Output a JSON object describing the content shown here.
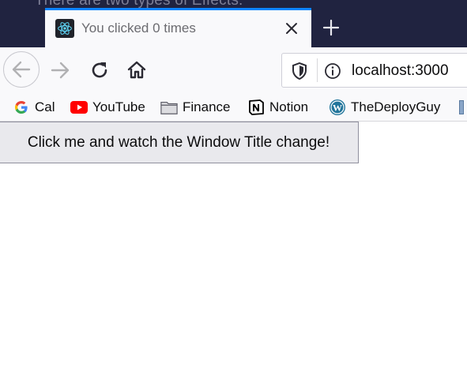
{
  "window": {
    "behind_text": "There are two types of Effects:"
  },
  "tab": {
    "title": "You clicked 0 times",
    "favicon": "react-logo-icon",
    "close_icon": "close-icon"
  },
  "toolbar": {
    "new_tab_icon": "plus-icon",
    "back_icon": "arrow-left-icon",
    "forward_icon": "arrow-right-icon",
    "reload_icon": "reload-icon",
    "home_icon": "home-icon"
  },
  "urlbar": {
    "url": "localhost:3000",
    "shield_icon": "shield-icon",
    "info_icon": "info-icon"
  },
  "bookmarks": [
    {
      "label": "Cal",
      "icon": "google-icon"
    },
    {
      "label": "YouTube",
      "icon": "youtube-icon"
    },
    {
      "label": "Finance",
      "icon": "folder-icon"
    },
    {
      "label": "Notion",
      "icon": "notion-icon"
    },
    {
      "label": "TheDeployGuy",
      "icon": "wordpress-icon"
    }
  ],
  "content": {
    "button_label": "Click me and watch the Window Title change!"
  },
  "colors": {
    "tabstrip": "#202340",
    "tab_accent": "#0a84ff",
    "toolbar": "#f9f9fb"
  }
}
